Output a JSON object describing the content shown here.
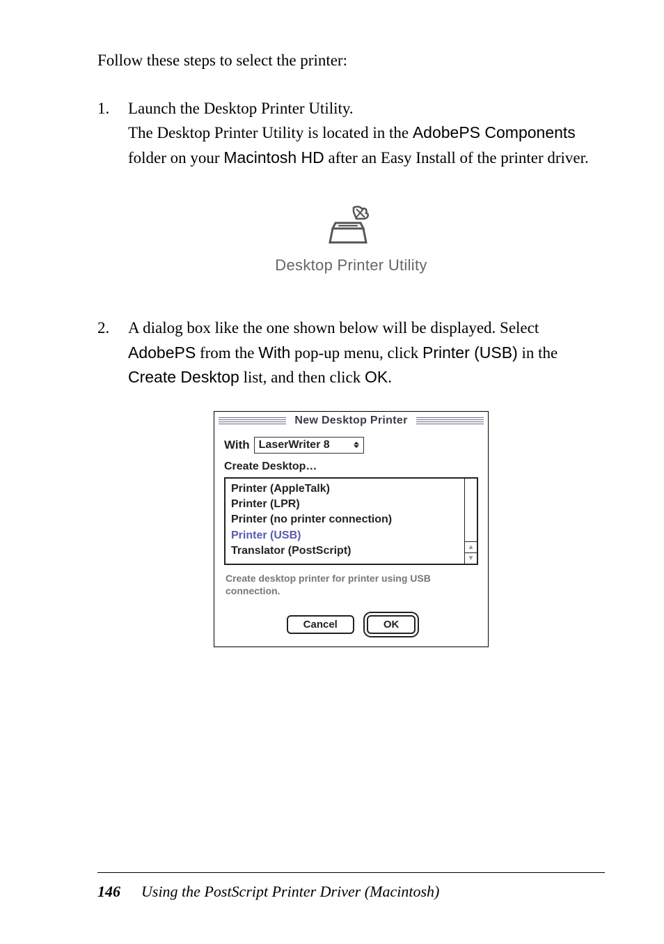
{
  "intro": "Follow these steps to select the printer:",
  "steps": [
    {
      "number": "1.",
      "parts": [
        {
          "text": "Launch the Desktop Printer Utility.\nThe Desktop Printer Utility is located in the "
        },
        {
          "text": "AdobePS Components",
          "bold": true
        },
        {
          "text": " folder on your "
        },
        {
          "text": "Macintosh HD",
          "bold": true
        },
        {
          "text": " after an Easy Install of the printer driver."
        }
      ]
    },
    {
      "number": "2.",
      "parts": [
        {
          "text": "A dialog box like the one shown below will be displayed. Select "
        },
        {
          "text": "AdobePS",
          "bold": true
        },
        {
          "text": " from the "
        },
        {
          "text": "With",
          "bold": true
        },
        {
          "text": " pop-up menu, click "
        },
        {
          "text": "Printer (USB)",
          "bold": true
        },
        {
          "text": " in the "
        },
        {
          "text": "Create Desktop",
          "bold": true
        },
        {
          "text": " list, and then click "
        },
        {
          "text": "OK",
          "bold": true
        },
        {
          "text": "."
        }
      ]
    }
  ],
  "figure1_caption": "Desktop Printer Utility",
  "dialog": {
    "title": "New Desktop Printer",
    "with_label": "With",
    "with_value": "LaserWriter 8",
    "create_label": "Create Desktop…",
    "items": [
      {
        "label": "Printer (AppleTalk)",
        "selected": false
      },
      {
        "label": "Printer (LPR)",
        "selected": false
      },
      {
        "label": "Printer (no printer connection)",
        "selected": false
      },
      {
        "label": "Printer (USB)",
        "selected": true
      },
      {
        "label": "Translator (PostScript)",
        "selected": false
      }
    ],
    "description": "Create desktop printer for printer using USB connection.",
    "cancel": "Cancel",
    "ok": "OK"
  },
  "footer": {
    "page": "146",
    "title": "Using the PostScript Printer Driver (Macintosh)"
  }
}
